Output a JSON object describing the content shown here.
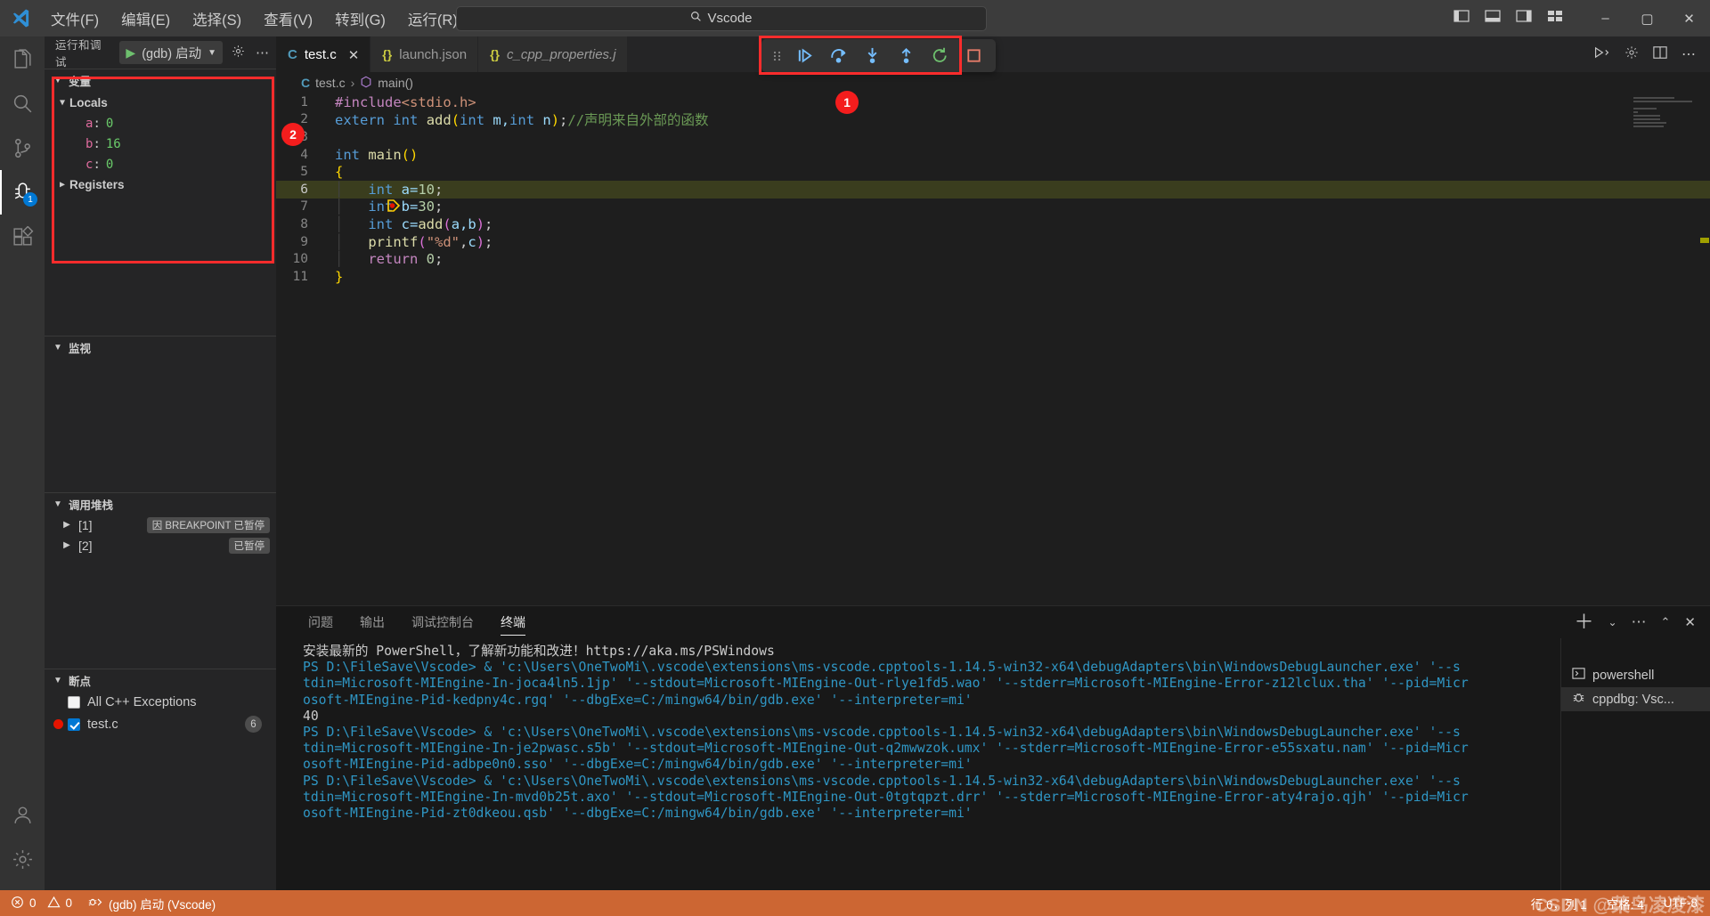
{
  "titlebar": {
    "logo": "vscode-logo",
    "menus": [
      "文件(F)",
      "编辑(E)",
      "选择(S)",
      "查看(V)",
      "转到(G)",
      "运行(R)",
      "…"
    ],
    "nav_back": "←",
    "nav_forward": "→",
    "search_value": "Vscode",
    "search_icon": "search-icon",
    "layout_icons": [
      "toggle-primary-sidebar-icon",
      "toggle-panel-icon",
      "toggle-secondary-sidebar-icon",
      "customize-layout-icon"
    ],
    "window_buttons": [
      "–",
      "▢",
      "✕"
    ]
  },
  "activitybar": {
    "items": [
      {
        "name": "explorer",
        "icon": "files-icon",
        "badge": ""
      },
      {
        "name": "search",
        "icon": "search-icon",
        "badge": ""
      },
      {
        "name": "source-control",
        "icon": "source-control-icon",
        "badge": ""
      },
      {
        "name": "run-and-debug",
        "icon": "debug-icon",
        "badge": "1"
      },
      {
        "name": "extensions",
        "icon": "extensions-icon",
        "badge": ""
      }
    ],
    "bottom": [
      {
        "name": "accounts",
        "icon": "account-icon"
      },
      {
        "name": "manage",
        "icon": "gear-icon"
      }
    ]
  },
  "sidebar": {
    "header": {
      "title": "运行和调试",
      "launch_config": "(gdb) 启动",
      "play_icon": "play-icon",
      "chevron": "▾",
      "gear_icon": "gear-icon",
      "more_icon": "more-icon"
    },
    "variables": {
      "title": "变量",
      "groups": [
        {
          "label": "Locals",
          "expanded": true,
          "items": [
            {
              "name": "a",
              "value": "0"
            },
            {
              "name": "b",
              "value": "16"
            },
            {
              "name": "c",
              "value": "0"
            }
          ]
        },
        {
          "label": "Registers",
          "expanded": false,
          "items": []
        }
      ]
    },
    "watch": {
      "title": "监视",
      "items": []
    },
    "callstack": {
      "title": "调用堆栈",
      "rows": [
        {
          "label": "[1]",
          "badge": "因 BREAKPOINT 已暂停"
        },
        {
          "label": "[2]",
          "badge": "已暂停"
        }
      ]
    },
    "breakpoints": {
      "title": "断点",
      "rows": [
        {
          "label": "All C++ Exceptions",
          "checked": false,
          "has_dot": false,
          "count": ""
        },
        {
          "label": "test.c",
          "checked": true,
          "has_dot": true,
          "count": "6"
        }
      ]
    }
  },
  "editor": {
    "tabs": [
      {
        "label": "test.c",
        "icon": "c-file-icon",
        "active": true,
        "italic": false,
        "closable": true
      },
      {
        "label": "launch.json",
        "icon": "json-file-icon",
        "active": false,
        "italic": false,
        "closable": false
      },
      {
        "label": "c_cpp_properties.j",
        "icon": "json-file-icon",
        "active": false,
        "italic": true,
        "closable": false
      }
    ],
    "tab_actions": [
      "run-or-debug-icon",
      "split-editor-icon",
      "more-actions-icon"
    ],
    "breadcrumb": {
      "file_icon": "c-file-icon",
      "file": "test.c",
      "separator": "›",
      "symbol_icon": "method-icon",
      "symbol": "main()"
    },
    "code_lines": [
      {
        "n": "1",
        "highlight": false,
        "breakpoint": false
      },
      {
        "n": "2",
        "highlight": false,
        "breakpoint": false
      },
      {
        "n": "3",
        "highlight": false,
        "breakpoint": false
      },
      {
        "n": "4",
        "highlight": false,
        "breakpoint": false
      },
      {
        "n": "5",
        "highlight": false,
        "breakpoint": false
      },
      {
        "n": "6",
        "highlight": true,
        "breakpoint": true
      },
      {
        "n": "7",
        "highlight": false,
        "breakpoint": false
      },
      {
        "n": "8",
        "highlight": false,
        "breakpoint": false
      },
      {
        "n": "9",
        "highlight": false,
        "breakpoint": false
      },
      {
        "n": "10",
        "highlight": false,
        "breakpoint": false
      },
      {
        "n": "11",
        "highlight": false,
        "breakpoint": false
      }
    ],
    "code_text": {
      "l1_include": "#include",
      "l1_header": "<stdio.h>",
      "l2_extern": "extern",
      "l2_int": "int",
      "l2_add": "add",
      "l2_open": "(",
      "l2_int2": "int",
      "l2_m": " m,",
      "l2_int3": "int",
      "l2_n": " n",
      "l2_close": ")",
      "l2_semi": ";",
      "l2_comment": "//声明来自外部的函数",
      "l4_int": "int",
      "l4_main": "main",
      "l4_paren": "()",
      "l5_brace": "{",
      "l6_int": "int",
      "l6_rest": " a=",
      "l6_num": "10",
      "l6_semi": ";",
      "l7_int": "int",
      "l7_rest": " b=",
      "l7_num": "30",
      "l7_semi": ";",
      "l8_int": "int",
      "l8_c": " c=",
      "l8_add": "add",
      "l8_open": "(",
      "l8_args": "a,b",
      "l8_close": ")",
      "l8_semi": ";",
      "l9_printf": "printf",
      "l9_open": "(",
      "l9_str": "\"%d\"",
      "l9_comma": ",",
      "l9_c": "c",
      "l9_close": ")",
      "l9_semi": ";",
      "l10_return": "return",
      "l10_num": " 0",
      "l10_semi": ";",
      "l11_brace": "}"
    }
  },
  "debug_toolbar": {
    "grip_icon": "drag-handle-icon",
    "buttons": [
      {
        "name": "continue-button",
        "icon": "continue-icon",
        "color": "#75beff"
      },
      {
        "name": "step-over-button",
        "icon": "step-over-icon",
        "color": "#75beff"
      },
      {
        "name": "step-into-button",
        "icon": "step-into-icon",
        "color": "#75beff"
      },
      {
        "name": "step-out-button",
        "icon": "step-out-icon",
        "color": "#75beff"
      },
      {
        "name": "restart-button",
        "icon": "restart-icon",
        "color": "#6ec06e"
      },
      {
        "name": "stop-button",
        "icon": "stop-icon",
        "color": "#e87d6a"
      }
    ]
  },
  "panel": {
    "tabs": [
      {
        "label": "问题",
        "active": false
      },
      {
        "label": "输出",
        "active": false
      },
      {
        "label": "调试控制台",
        "active": false
      },
      {
        "label": "终端",
        "active": true
      }
    ],
    "actions": [
      "new-terminal-icon",
      "chevron-down-icon",
      "more-actions-icon",
      "maximize-panel-icon",
      "close-panel-icon"
    ],
    "terminal_lines": [
      {
        "text": "安装最新的 PowerShell，了解新功能和改进！https://aka.ms/PSWindows",
        "color": "white"
      },
      {
        "text": "",
        "color": "white"
      },
      {
        "text": "PS D:\\FileSave\\Vscode> & 'c:\\Users\\OneTwoMi\\.vscode\\extensions\\ms-vscode.cpptools-1.14.5-win32-x64\\debugAdapters\\bin\\WindowsDebugLauncher.exe' '--s",
        "color": "mix"
      },
      {
        "text": "tdin=Microsoft-MIEngine-In-joca4ln5.1jp' '--stdout=Microsoft-MIEngine-Out-rlye1fd5.wao' '--stderr=Microsoft-MIEngine-Error-z12lclux.tha' '--pid=Micr",
        "color": "cyan"
      },
      {
        "text": "osoft-MIEngine-Pid-kedpny4c.rgq' '--dbgExe=C:/mingw64/bin/gdb.exe' '--interpreter=mi'",
        "color": "cyan"
      },
      {
        "text": "40",
        "color": "white"
      },
      {
        "text": "PS D:\\FileSave\\Vscode> & 'c:\\Users\\OneTwoMi\\.vscode\\extensions\\ms-vscode.cpptools-1.14.5-win32-x64\\debugAdapters\\bin\\WindowsDebugLauncher.exe' '--s",
        "color": "mix"
      },
      {
        "text": "tdin=Microsoft-MIEngine-In-je2pwasc.s5b' '--stdout=Microsoft-MIEngine-Out-q2mwwzok.umx' '--stderr=Microsoft-MIEngine-Error-e55sxatu.nam' '--pid=Micr",
        "color": "cyan"
      },
      {
        "text": "osoft-MIEngine-Pid-adbpe0n0.sso' '--dbgExe=C:/mingw64/bin/gdb.exe' '--interpreter=mi'",
        "color": "cyan"
      },
      {
        "text": "PS D:\\FileSave\\Vscode> & 'c:\\Users\\OneTwoMi\\.vscode\\extensions\\ms-vscode.cpptools-1.14.5-win32-x64\\debugAdapters\\bin\\WindowsDebugLauncher.exe' '--s",
        "color": "mix"
      },
      {
        "text": "tdin=Microsoft-MIEngine-In-mvd0b25t.axo' '--stdout=Microsoft-MIEngine-Out-0tgtqpzt.drr' '--stderr=Microsoft-MIEngine-Error-aty4rajo.qjh' '--pid=Micr",
        "color": "cyan"
      },
      {
        "text": "osoft-MIEngine-Pid-zt0dkeou.qsb' '--dbgExe=C:/mingw64/bin/gdb.exe' '--interpreter=mi'",
        "color": "cyan"
      }
    ],
    "terminal_list": [
      {
        "label": "powershell",
        "icon": "terminal-icon",
        "active": false
      },
      {
        "label": "cppdbg: Vsc...",
        "icon": "debug-console-icon",
        "active": true
      }
    ]
  },
  "statusbar": {
    "errors_icon": "error-icon",
    "errors": "0",
    "warnings_icon": "warning-icon",
    "warnings": "0",
    "debug_icon": "debug-status-icon",
    "debug_session": "(gdb) 启动 (Vscode)",
    "cursor": "行 6，列 1",
    "indent": "空格: 4",
    "encoding": "UTF-8",
    "watermark": "CSDN @菜鸟凌凌漆",
    "accent_color": "#cc6633"
  },
  "annotations": [
    {
      "id": "1",
      "label": "1"
    },
    {
      "id": "2",
      "label": "2"
    }
  ]
}
